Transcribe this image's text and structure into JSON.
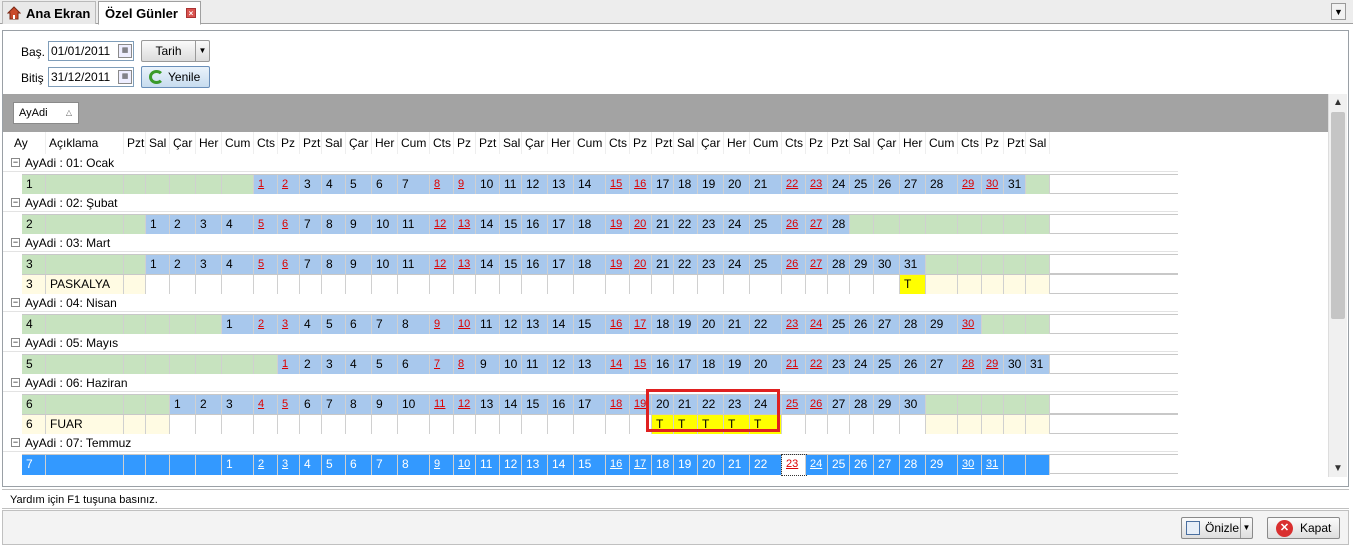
{
  "tabs": {
    "home": "Ana Ekran",
    "active": "Özel Günler"
  },
  "filters": {
    "start_label": "Baş.",
    "start_value": "01/01/2011",
    "end_label": "Bitiş",
    "end_value": "31/12/2011",
    "mode_label": "Tarih",
    "refresh_label": "Yenile"
  },
  "group_by": "AyAdi",
  "headers": [
    "Ay",
    "Açıklama",
    "Pzt",
    "Sal",
    "Çar",
    "Her",
    "Cum",
    "Cts",
    "Pz",
    "Pzt",
    "Sal",
    "Çar",
    "Her",
    "Cum",
    "Cts",
    "Pz",
    "Pzt",
    "Sal",
    "Çar",
    "Her",
    "Cum",
    "Cts",
    "Pz",
    "Pzt",
    "Sal",
    "Çar",
    "Her",
    "Cum",
    "Cts",
    "Pz",
    "Pzt",
    "Sal",
    "Çar",
    "Her",
    "Cum",
    "Cts",
    "Pz",
    "Pzt",
    "Sal"
  ],
  "groups": [
    {
      "label": "AyAdi : 01: Ocak",
      "rows": [
        {
          "ay": "1",
          "aciklama": "",
          "offset": 5,
          "days": 31,
          "kind": "month"
        }
      ]
    },
    {
      "label": "AyAdi : 02: Şubat",
      "rows": [
        {
          "ay": "2",
          "aciklama": "",
          "offset": 1,
          "days": 28,
          "kind": "month"
        }
      ]
    },
    {
      "label": "AyAdi : 03: Mart",
      "rows": [
        {
          "ay": "3",
          "aciklama": "",
          "offset": 1,
          "days": 31,
          "kind": "month"
        },
        {
          "ay": "3",
          "aciklama": "PASKALYA",
          "offset": 1,
          "days": 31,
          "kind": "event",
          "marks": [
            31
          ],
          "mark_text": "T"
        }
      ]
    },
    {
      "label": "AyAdi : 04: Nisan",
      "rows": [
        {
          "ay": "4",
          "aciklama": "",
          "offset": 4,
          "days": 30,
          "kind": "month"
        }
      ]
    },
    {
      "label": "AyAdi : 05: Mayıs",
      "rows": [
        {
          "ay": "5",
          "aciklama": "",
          "offset": 6,
          "days": 31,
          "kind": "month"
        }
      ]
    },
    {
      "label": "AyAdi : 06: Haziran",
      "rows": [
        {
          "ay": "6",
          "aciklama": "",
          "offset": 2,
          "days": 30,
          "kind": "month"
        },
        {
          "ay": "6",
          "aciklama": "FUAR",
          "offset": 2,
          "days": 30,
          "kind": "event",
          "marks": [
            20,
            21,
            22,
            23,
            24
          ],
          "mark_text": "T"
        }
      ]
    },
    {
      "label": "AyAdi : 07: Temmuz",
      "rows": [
        {
          "ay": "7",
          "aciklama": "",
          "offset": 4,
          "days": 31,
          "kind": "month",
          "selected": true,
          "focus_day": 23
        }
      ]
    }
  ],
  "status_text": "Yardım için F1 tuşuna basınız.",
  "buttons": {
    "preview": "Önizle",
    "close": "Kapat"
  },
  "colors": {
    "month_bg": "#c7e3bf",
    "day_bg": "#a8c8ed",
    "event_bg": "#fffbe3",
    "mark_bg": "#ffff00",
    "selected_bg": "#3399ff",
    "weekend_text": "#d00000",
    "highlight_box": "#e02020"
  }
}
